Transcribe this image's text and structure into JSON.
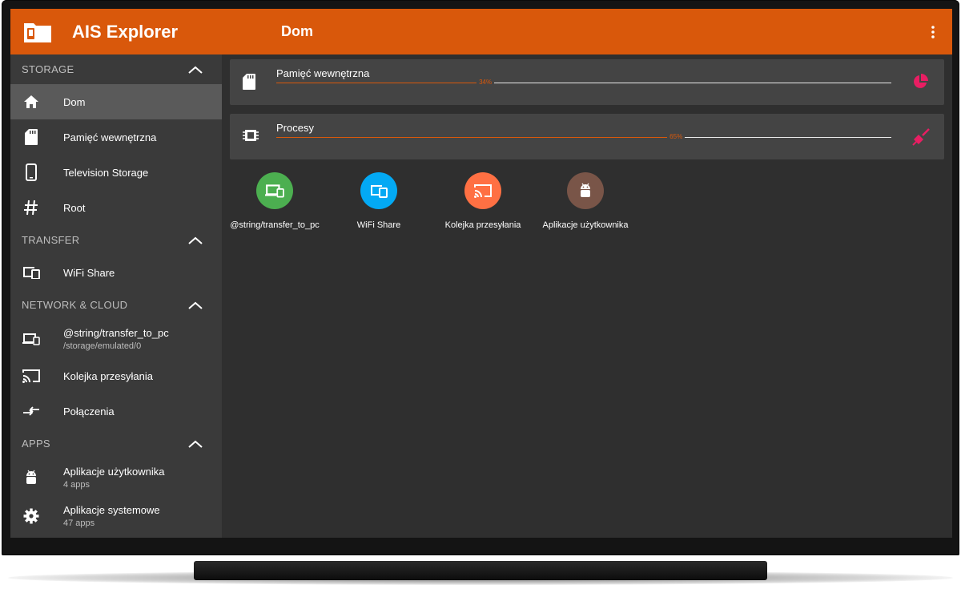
{
  "app": {
    "title": "AIS Explorer",
    "page_title": "Dom"
  },
  "sidebar": {
    "sections": [
      {
        "header": "STORAGE",
        "items": [
          {
            "label": "Dom",
            "icon": "home-icon",
            "active": true
          },
          {
            "label": "Pamięć wewnętrzna",
            "icon": "sd-card-icon"
          },
          {
            "label": "Television Storage",
            "icon": "phone-icon"
          },
          {
            "label": "Root",
            "icon": "hash-icon"
          }
        ]
      },
      {
        "header": "TRANSFER",
        "items": [
          {
            "label": "WiFi Share",
            "icon": "devices-icon"
          }
        ]
      },
      {
        "header": "NETWORK & CLOUD",
        "items": [
          {
            "label": "@string/transfer_to_pc",
            "sub": "/storage/emulated/0",
            "icon": "laptop-phone-icon"
          },
          {
            "label": "Kolejka przesyłania",
            "icon": "cast-icon"
          },
          {
            "label": "Połączenia",
            "icon": "swap-arrows-icon"
          }
        ]
      },
      {
        "header": "APPS",
        "items": [
          {
            "label": "Aplikacje użytkownika",
            "sub": "4 apps",
            "icon": "android-icon"
          },
          {
            "label": "Aplikacje systemowe",
            "sub": "47 apps",
            "icon": "gear-icon"
          }
        ]
      }
    ]
  },
  "cards": [
    {
      "label": "Pamięć wewnętrzna",
      "percent_text": "34%",
      "percent": 34,
      "icon": "sd-card-icon",
      "action_icon": "pie-chart-icon"
    },
    {
      "label": "Procesy",
      "percent_text": "65%",
      "percent": 65,
      "icon": "chip-icon",
      "action_icon": "broom-icon"
    }
  ],
  "shortcuts": [
    {
      "label": "@string/transfer_to_pc",
      "color": "#4caf50",
      "icon": "laptop-phone-icon"
    },
    {
      "label": "WiFi Share",
      "color": "#03a9f4",
      "icon": "devices-icon"
    },
    {
      "label": "Kolejka przesyłania",
      "color": "#ff7043",
      "icon": "cast-icon"
    },
    {
      "label": "Aplikacje użytkownika",
      "color": "#795548",
      "icon": "android-icon"
    }
  ],
  "colors": {
    "accent": "#d9580b",
    "action": "#e91e63"
  }
}
